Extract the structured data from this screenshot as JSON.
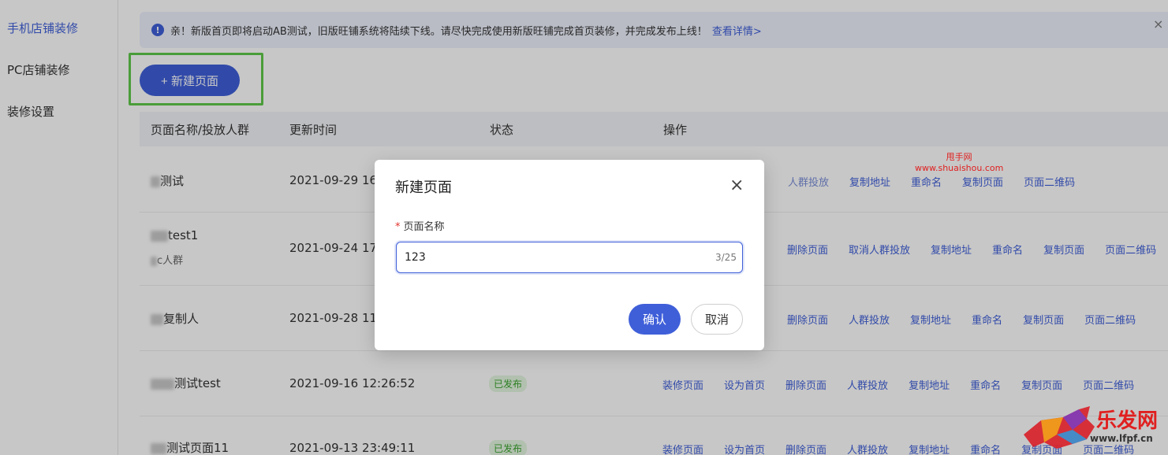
{
  "sidebar": {
    "items": [
      {
        "label": "手机店铺装修",
        "active": true
      },
      {
        "label": "PC店铺装修",
        "active": false
      },
      {
        "label": "装修设置",
        "active": false
      }
    ]
  },
  "notice": {
    "icon": "!",
    "text": "亲！新版首页即将启动AB测试，旧版旺铺系统将陆续下线。请尽快完成使用新版旺铺完成首页装修，并完成发布上线！",
    "link": "查看详情>",
    "close": "×"
  },
  "new_page_button": "+ 新建页面",
  "table": {
    "columns": [
      "页面名称/投放人群",
      "更新时间",
      "状态",
      "操作"
    ],
    "rows": [
      {
        "name": "测试",
        "name_prefix_blurred": true,
        "sub": "",
        "time": "2021-09-29 16:2",
        "status": "",
        "ops": [
          "人群投放",
          "复制地址",
          "重命名",
          "复制页面",
          "页面二维码"
        ]
      },
      {
        "name": "test1",
        "name_prefix_blurred": true,
        "sub": "c人群",
        "time": "2021-09-24 17:3",
        "status": "",
        "ops": [
          "删除页面",
          "取消人群投放",
          "复制地址",
          "重命名",
          "复制页面",
          "页面二维码"
        ]
      },
      {
        "name": "复制人",
        "name_prefix_blurred": true,
        "sub": "",
        "time": "2021-09-28 11:4",
        "status": "",
        "ops": [
          "删除页面",
          "人群投放",
          "复制地址",
          "重命名",
          "复制页面",
          "页面二维码"
        ]
      },
      {
        "name": "测试test",
        "name_prefix_blurred": true,
        "sub": "",
        "time": "2021-09-16 12:26:52",
        "status": "已发布",
        "ops": [
          "装修页面",
          "设为首页",
          "删除页面",
          "人群投放",
          "复制地址",
          "重命名",
          "复制页面",
          "页面二维码"
        ]
      },
      {
        "name": "测试页面11",
        "name_prefix_blurred": true,
        "sub": "",
        "time": "2021-09-13 23:49:11",
        "status": "已发布",
        "ops": [
          "装修页面",
          "设为首页",
          "删除页面",
          "人群投放",
          "复制地址",
          "重命名",
          "复制页面",
          "页面二维码"
        ]
      }
    ]
  },
  "modal": {
    "title": "新建页面",
    "close": "×",
    "required_mark": "*",
    "field_label": "页面名称",
    "field_value": "123",
    "field_count": "3/25",
    "confirm": "确认",
    "cancel": "取消"
  },
  "watermarks": {
    "top_line1": "甩手网",
    "top_line2": "www.shuaishou.com",
    "brand": "乐发网",
    "url": "www.lfpf.cn"
  },
  "colors": {
    "accent": "#3f5fd9",
    "success_bg": "#e5f6e0",
    "success_text": "#3aa52f",
    "highlight_frame": "#5fc94a"
  }
}
